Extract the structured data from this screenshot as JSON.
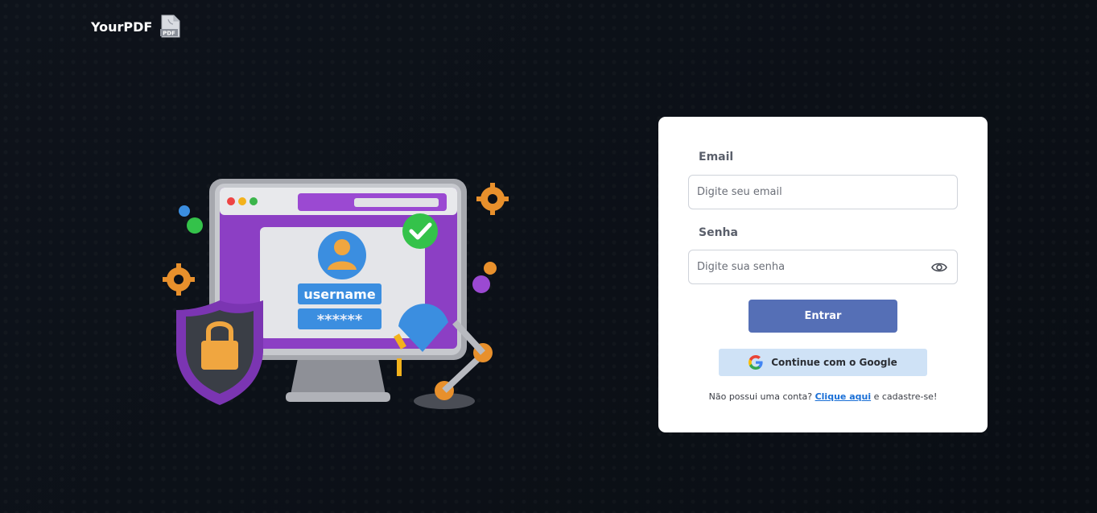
{
  "app": {
    "brand_name": "YourPDF",
    "pdf_icon_text": "PDF"
  },
  "illustration": {
    "username_text": "username",
    "password_mask": "******",
    "colors": {
      "frame": "#9a9ca3",
      "screen_bg": "#8c3fc4",
      "check_green": "#34c24a",
      "lock_orange": "#f0a640",
      "shield_purple": "#7b35b2",
      "gear_orange": "#e8902c",
      "lamp_blue": "#3b8ee0"
    }
  },
  "login": {
    "email_label": "Email",
    "email_placeholder": "Digite seu email",
    "email_value": "",
    "password_label": "Senha",
    "password_placeholder": "Digite sua senha",
    "password_value": "",
    "eye_icon": "eye-icon",
    "submit_label": "Entrar",
    "google_label": "Continue com o Google",
    "signup_prefix": "Não possui uma conta?",
    "signup_link": "Clique aqui",
    "signup_suffix": "e cadastre-se!"
  },
  "colors": {
    "page_bg": "#0d1118",
    "card_bg": "#ffffff",
    "primary_button": "#556fb6",
    "google_button": "#cfe2f6",
    "link": "#1a6fd6"
  }
}
